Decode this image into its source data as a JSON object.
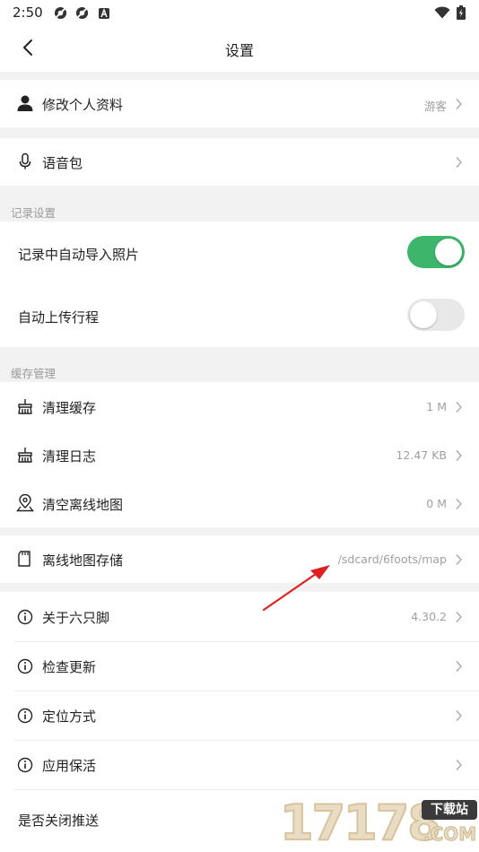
{
  "status_bar": {
    "time": "2:50"
  },
  "header": {
    "title": "设置"
  },
  "profile": {
    "label": "修改个人资料",
    "value": "游客"
  },
  "voice": {
    "label": "语音包"
  },
  "record_settings": {
    "header": "记录设置",
    "auto_import": {
      "label": "记录中自动导入照片",
      "state": "on"
    },
    "auto_upload": {
      "label": "自动上传行程",
      "state": "off"
    }
  },
  "cache_management": {
    "header": "缓存管理",
    "clear_cache": {
      "label": "清理缓存",
      "value": "1 M"
    },
    "clear_logs": {
      "label": "清理日志",
      "value": "12.47 KB"
    },
    "clear_offline_maps": {
      "label": "清空离线地图",
      "value": "0 M"
    }
  },
  "offline_storage": {
    "label": "离线地图存储",
    "value": "/sdcard/6foots/map"
  },
  "about": {
    "label": "关于六只脚",
    "value": "4.30.2"
  },
  "check_update": {
    "label": "检查更新"
  },
  "location_method": {
    "label": "定位方式"
  },
  "app_keepalive": {
    "label": "应用保活"
  },
  "push_toggle": {
    "label": "是否关闭推送"
  },
  "watermark": {
    "number": "17178",
    "badge": "下载站",
    "domain": ".COM"
  },
  "colors": {
    "toggle_on": "#3db56b",
    "toggle_off": "#e8e8e8",
    "annotation_arrow": "#e02020"
  }
}
